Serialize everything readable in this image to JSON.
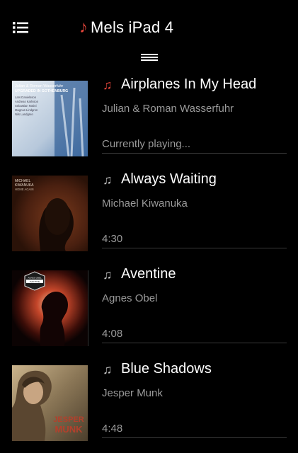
{
  "header": {
    "title": "Mels iPad 4",
    "note_glyph": "♪",
    "accent_color": "#e2443a"
  },
  "songs": [
    {
      "title": "Airplanes In My Head",
      "artist": "Julian & Roman Wasserfuhr",
      "status": "Currently playing...",
      "playing": true,
      "art": {
        "header_line": "Julian & Roman Wasserfuhr",
        "album_line": "UPGRADED IN GOTHENBURG",
        "credit_lines": [
          "Lars Danielsson",
          "Andreas Karlsson",
          "Sebastian Notini",
          "Magnus Lindgren",
          "Nils Landgren"
        ]
      }
    },
    {
      "title": "Always Waiting",
      "artist": "Michael Kiwanuka",
      "status": "4:30",
      "playing": false,
      "art": {
        "header_line": "MICHAEL",
        "album_line": "KIWANUKA",
        "sub_line": "HOME AGAIN"
      }
    },
    {
      "title": "Aventine",
      "artist": "Agnes Obel",
      "status": "4:08",
      "playing": false,
      "art": {
        "badge_top": "AGNES OBEL",
        "badge_bottom": "AVENTINE"
      }
    },
    {
      "title": "Blue Shadows",
      "artist": "Jesper Munk",
      "status": "4:48",
      "playing": false,
      "art": {
        "name_top": "JESPER",
        "name_bottom": "MUNK"
      }
    }
  ],
  "icons": {
    "menu": "list-icon",
    "handle": "drag-handle-icon",
    "note": "music-note-icon"
  }
}
